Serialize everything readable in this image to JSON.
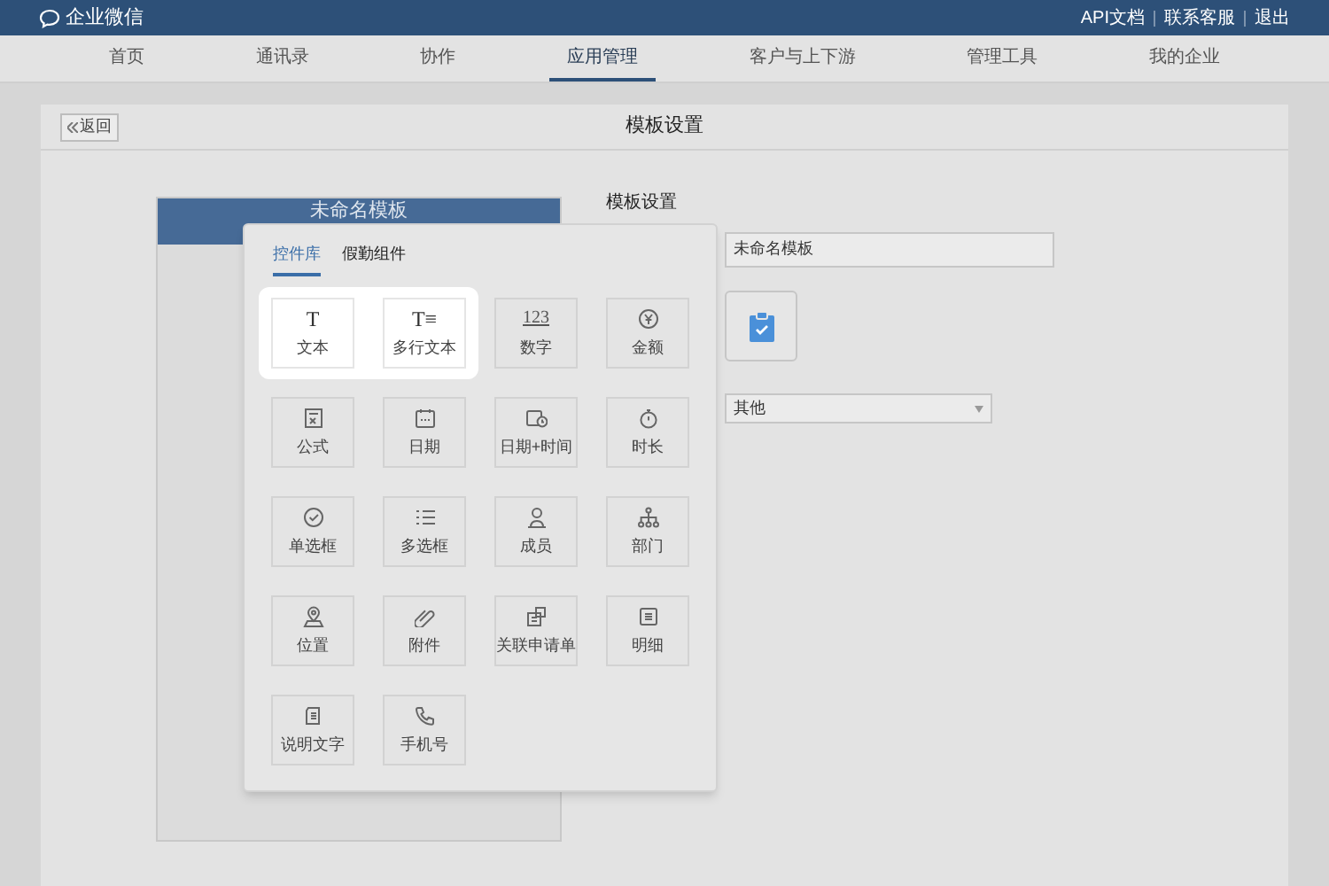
{
  "app": {
    "name": "企业微信",
    "links": [
      "API文档",
      "联系客服",
      "退出"
    ]
  },
  "nav": [
    {
      "label": "首页",
      "selected": false
    },
    {
      "label": "通讯录",
      "selected": false
    },
    {
      "label": "协作",
      "selected": false
    },
    {
      "label": "应用管理",
      "selected": true
    },
    {
      "label": "客户与上下游",
      "selected": false
    },
    {
      "label": "管理工具",
      "selected": false
    },
    {
      "label": "我的企业",
      "selected": false
    }
  ],
  "page": {
    "back": "返回",
    "title": "模板设置"
  },
  "preview": {
    "title": "未命名模板"
  },
  "settings": {
    "heading": "模板设置",
    "name_value": "未命名模板",
    "category_value": "其他"
  },
  "popover": {
    "tabs": [
      {
        "label": "控件库",
        "selected": true
      },
      {
        "label": "假勤组件",
        "selected": false
      }
    ],
    "controls": [
      {
        "label": "文本",
        "glyph": "T",
        "highlighted": true
      },
      {
        "label": "多行文本",
        "glyph": "T≡",
        "highlighted": true
      },
      {
        "label": "数字",
        "glyph": "123",
        "highlighted": false
      },
      {
        "label": "金额",
        "highlighted": false
      },
      {
        "label": "公式",
        "highlighted": false
      },
      {
        "label": "日期",
        "highlighted": false
      },
      {
        "label": "日期+时间",
        "highlighted": false
      },
      {
        "label": "时长",
        "highlighted": false
      },
      {
        "label": "单选框",
        "highlighted": false
      },
      {
        "label": "多选框",
        "highlighted": false
      },
      {
        "label": "成员",
        "highlighted": false
      },
      {
        "label": "部门",
        "highlighted": false
      },
      {
        "label": "位置",
        "highlighted": false
      },
      {
        "label": "附件",
        "highlighted": false
      },
      {
        "label": "关联申请单",
        "highlighted": false
      },
      {
        "label": "明细",
        "highlighted": false
      },
      {
        "label": "说明文字",
        "highlighted": false
      },
      {
        "label": "手机号",
        "highlighted": false
      }
    ]
  }
}
